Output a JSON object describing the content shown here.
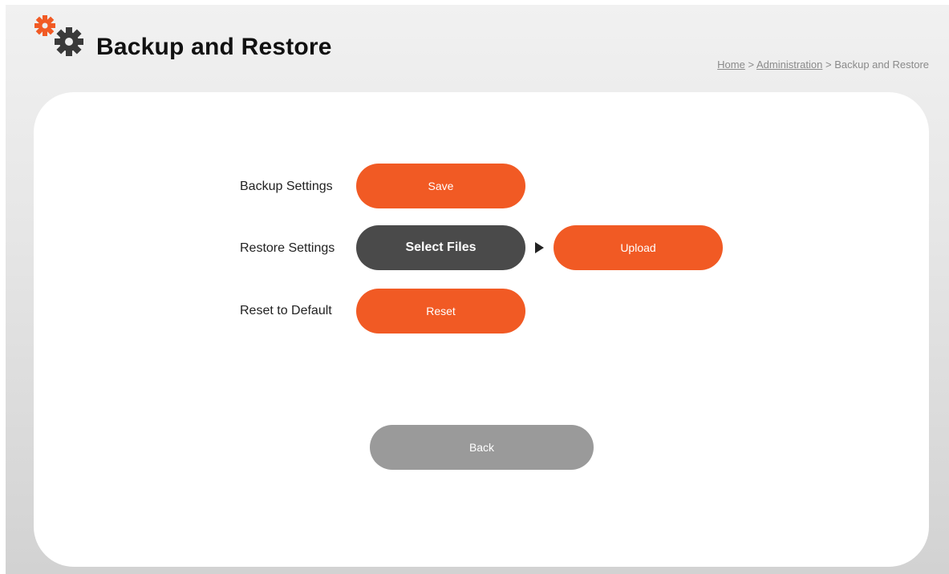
{
  "header": {
    "title": "Backup and Restore",
    "icon": "gears-icon",
    "accent_color": "#f15a24"
  },
  "breadcrumb": {
    "home": "Home",
    "sep1": ">",
    "admin": "Administration",
    "sep2": ">",
    "current": "Backup and Restore"
  },
  "backup": {
    "label": "Backup Settings",
    "button": "Save"
  },
  "restore": {
    "label": "Restore Settings",
    "select_button": "Select Files",
    "arrow_icon": "play-arrow-icon",
    "upload_button": "Upload"
  },
  "reset": {
    "label": "Reset to Default",
    "button": "Reset"
  },
  "footer": {
    "back_button": "Back"
  }
}
